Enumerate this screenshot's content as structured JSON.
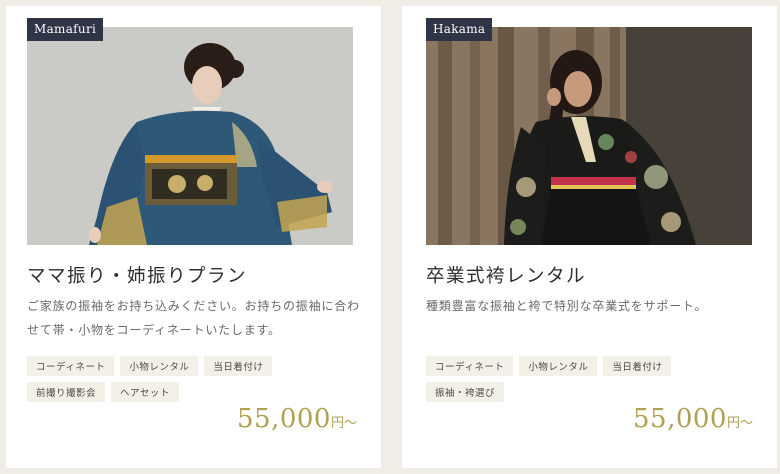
{
  "cards": [
    {
      "badge": "Mamafuri",
      "title": "ママ振り・姉振りプラン",
      "description": "ご家族の振袖をお持ち込みください。お持ちの振袖に合わせて帯・小物をコーディネートいたします。",
      "tags": [
        "コーディネート",
        "小物レンタル",
        "当日着付け",
        "前撮り撮影会",
        "ヘアセット"
      ],
      "price": "55,000",
      "price_unit": "円〜"
    },
    {
      "badge": "Hakama",
      "title": "卒業式袴レンタル",
      "description": "種類豊富な振袖と袴で特別な卒業式をサポート。",
      "tags": [
        "コーディネート",
        "小物レンタル",
        "当日着付け",
        "振袖・袴選び"
      ],
      "price": "55,000",
      "price_unit": "円〜"
    }
  ],
  "colors": {
    "background": "#efede6",
    "badge": "#2f3546",
    "price": "#b0a052",
    "tag_bg": "#f3f1e7"
  }
}
